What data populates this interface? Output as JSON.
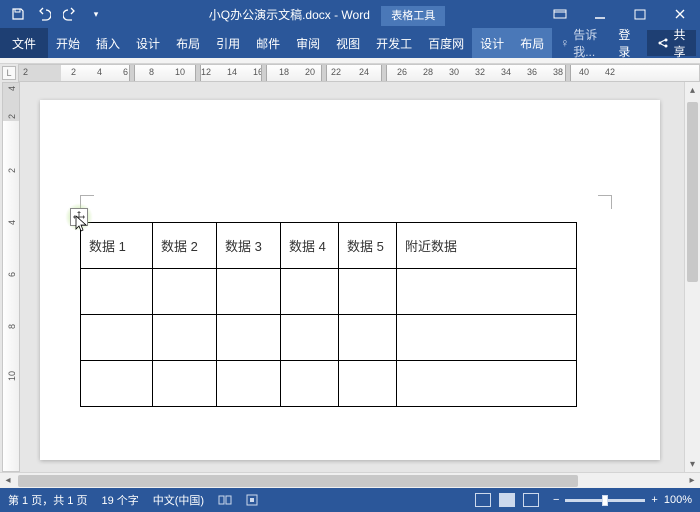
{
  "titlebar": {
    "doc_name": "小Q办公演示文稿.docx - Word",
    "tools_label": "表格工具"
  },
  "ribbon": {
    "file": "文件",
    "tabs": [
      "开始",
      "插入",
      "设计",
      "布局",
      "引用",
      "邮件",
      "审阅",
      "视图",
      "开发工",
      "百度网"
    ],
    "contextual": [
      "设计",
      "布局"
    ],
    "tell_me": "告诉我...",
    "login": "登录",
    "share": "共享"
  },
  "ruler": {
    "h_numbers": [
      "2",
      "2",
      "4",
      "6",
      "8",
      "10",
      "12",
      "14",
      "16",
      "18",
      "20",
      "22",
      "24",
      "26",
      "28",
      "30",
      "32",
      "34",
      "36",
      "38",
      "40",
      "42"
    ],
    "h_positions": [
      4,
      52,
      78,
      104,
      130,
      156,
      182,
      208,
      234,
      260,
      286,
      312,
      340,
      378,
      404,
      430,
      456,
      482,
      508,
      534,
      560,
      586
    ],
    "col_markers": [
      110,
      176,
      242,
      302,
      362,
      546
    ],
    "v_numbers": [
      "4",
      "2",
      "2",
      "4",
      "6",
      "8",
      "10"
    ],
    "v_positions": [
      8,
      36,
      90,
      142,
      194,
      246,
      298
    ]
  },
  "table": {
    "headers": [
      "数据 1",
      "数据 2",
      "数据 3",
      "数据 4",
      "数据 5",
      "附近数据"
    ],
    "rows": 4
  },
  "status": {
    "page": "第 1 页，共 1 页",
    "words": "19 个字",
    "lang": "中文(中国)",
    "zoom_minus": "−",
    "zoom_plus": "+",
    "zoom_pct": "100%"
  }
}
